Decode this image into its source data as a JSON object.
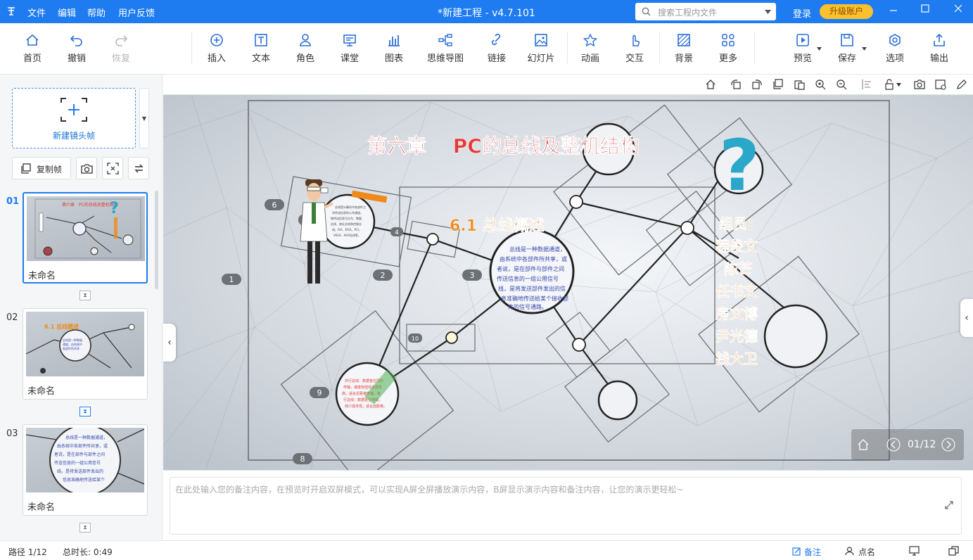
{
  "titlebar": {
    "menu": [
      "文件",
      "编辑",
      "帮助",
      "用户反馈"
    ],
    "title": "*新建工程 - v4.7.101",
    "search_placeholder": "搜索工程内文件",
    "login": "登录",
    "upgrade": "升级账户"
  },
  "toolbar": {
    "home": "首页",
    "undo": "撤销",
    "redo": "恢复",
    "insert": "插入",
    "text": "文本",
    "role": "角色",
    "classroom": "课堂",
    "chart": "图表",
    "mindmap": "思维导图",
    "link": "链接",
    "slides": "幻灯片",
    "animation": "动画",
    "interact": "交互",
    "background": "背景",
    "more": "更多",
    "preview": "预览",
    "save": "保存",
    "options": "选项",
    "export": "输出"
  },
  "sidebar": {
    "new_frame": "新建镜头帧",
    "copy_frame": "复制帧",
    "slides": [
      {
        "num": "01",
        "label": "未命名"
      },
      {
        "num": "02",
        "label": "未命名"
      },
      {
        "num": "03",
        "label": "未命名"
      }
    ]
  },
  "slide": {
    "title": "第六章　 PC的总线及整机结构",
    "subtitle": "6.1  总线概述",
    "body": "总线是一种数据通道，由系统中各部件所共享，或者说，是在部件与部件之间传送信息的一组公用信号线，是将发送部件发出的信息准确地传送给某个接收部件的信号通路。",
    "members_title": "组员：",
    "members": [
      "程俊文",
      "陈芒",
      "任书文",
      "房文博",
      "尹光德",
      "钱大卫"
    ],
    "frame_numbers": [
      "1",
      "2",
      "3",
      "4",
      "6",
      "7",
      "8",
      "9",
      "10"
    ],
    "question_mark": "?"
  },
  "thumbs": {
    "t1_title": "第六章　PC的总线及整机结构",
    "t2_title": "6.1 总线概述",
    "t3_body": "总线是一种数据通道，由系统中各部件所共享，或者说，是在部件与部件之间传送信息的一组公用信号线，是将发送部件发出的信息准确地传送给某个接收部件的信号通路。"
  },
  "pager": {
    "text": "01/12"
  },
  "notes": {
    "placeholder": "在此处输入您的备注内容，在预览时开启双屏模式，可以实现A屏全屏播放演示内容，B屏显示演示内容和备注内容，让您的演示更轻松~"
  },
  "status": {
    "path": "路径 1/12",
    "duration": "总时长: 0:49",
    "notes_btn": "备注",
    "rollcall": "点名"
  },
  "colors": {
    "accent": "#1e7cf0",
    "title_red": "#e53935",
    "orange": "#ef8a1a",
    "question": "#2aa7c9",
    "upgrade": "#fbc02d"
  }
}
